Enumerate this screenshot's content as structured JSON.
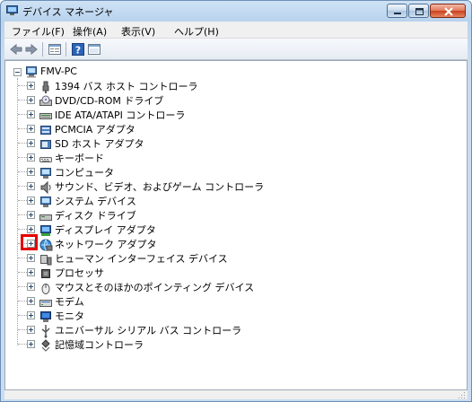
{
  "window": {
    "title": "デバイス マネージャ"
  },
  "menu": [
    "ファイル(F)",
    "操作(A)",
    "表示(V)",
    "ヘルプ(H)"
  ],
  "toolbar": [
    "back-icon",
    "forward-icon",
    "properties-view-icon",
    "help-icon",
    "show-hidden-icon"
  ],
  "tree": {
    "root": "FMV-PC",
    "items": [
      {
        "label": "1394 バス ホスト コントローラ",
        "icon": "1394-controller-icon"
      },
      {
        "label": "DVD/CD-ROM ドライブ",
        "icon": "dvd-drive-icon"
      },
      {
        "label": "IDE ATA/ATAPI コントローラ",
        "icon": "ide-controller-icon"
      },
      {
        "label": "PCMCIA アダプタ",
        "icon": "pcmcia-adapter-icon"
      },
      {
        "label": "SD ホスト アダプタ",
        "icon": "sd-host-icon"
      },
      {
        "label": "キーボード",
        "icon": "keyboard-icon"
      },
      {
        "label": "コンピュータ",
        "icon": "computer-icon"
      },
      {
        "label": "サウンド、ビデオ、およびゲーム コントローラ",
        "icon": "sound-icon"
      },
      {
        "label": "システム デバイス",
        "icon": "system-device-icon"
      },
      {
        "label": "ディスク ドライブ",
        "icon": "disk-drive-icon"
      },
      {
        "label": "ディスプレイ アダプタ",
        "icon": "display-adapter-icon"
      },
      {
        "label": "ネットワーク アダプタ",
        "icon": "network-adapter-icon"
      },
      {
        "label": "ヒューマン インターフェイス デバイス",
        "icon": "hid-icon"
      },
      {
        "label": "プロセッサ",
        "icon": "processor-icon"
      },
      {
        "label": "マウスとそのほかのポインティング デバイス",
        "icon": "mouse-icon"
      },
      {
        "label": "モデム",
        "icon": "modem-icon"
      },
      {
        "label": "モニタ",
        "icon": "monitor-icon"
      },
      {
        "label": "ユニバーサル シリアル バス コントローラ",
        "icon": "usb-controller-icon"
      },
      {
        "label": "記憶域コントローラ",
        "icon": "storage-controller-icon"
      }
    ]
  },
  "highlighted_item": "ネットワーク アダプタ",
  "colors": {
    "highlight_box": "#e30000",
    "titlebar": "#b9d3ee"
  }
}
